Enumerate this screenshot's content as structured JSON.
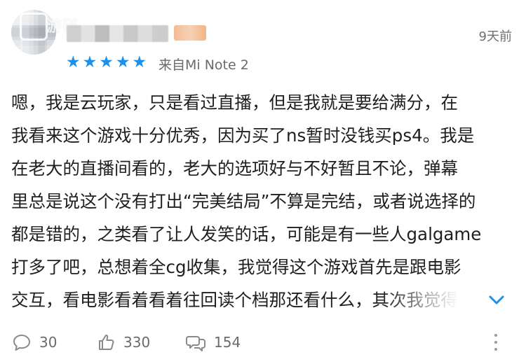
{
  "watermark": {
    "text": "游研"
  },
  "header": {
    "date": "9天前",
    "rating_stars": 5,
    "device": "来自Mi Note 2"
  },
  "comment": {
    "lines": [
      "嗯，我是云玩家，只是看过直播，但是我就是要给满分，在",
      "我看来这个游戏十分优秀，因为买了ns暂时没钱买ps4。我是",
      "在老大的直播间看的，老大的选项好与不好暂且不论，弹幕",
      "里总是说这个没有打出“完美结局”不算是完结，或者说选择的",
      "都是错的，之类看了让人发笑的话，可能是有一些人galgame",
      "打多了吧，总想着全cg收集，我觉得这个游戏首先是跟电影",
      "交互，看电影看着看着往回读个档那还看什么，其次我觉得"
    ]
  },
  "footer": {
    "comments_count": "30",
    "likes_count": "330",
    "reposts_count": "154"
  },
  "colors": {
    "accent": "#1e90e8",
    "muted_text": "#6f6f6f"
  },
  "icons": {
    "expand": "chevron-down-icon",
    "comment": "comment-bubble-icon",
    "like": "thumbs-up-icon",
    "repost": "repost-bubbles-icon",
    "more": "more-vertical-icon"
  }
}
